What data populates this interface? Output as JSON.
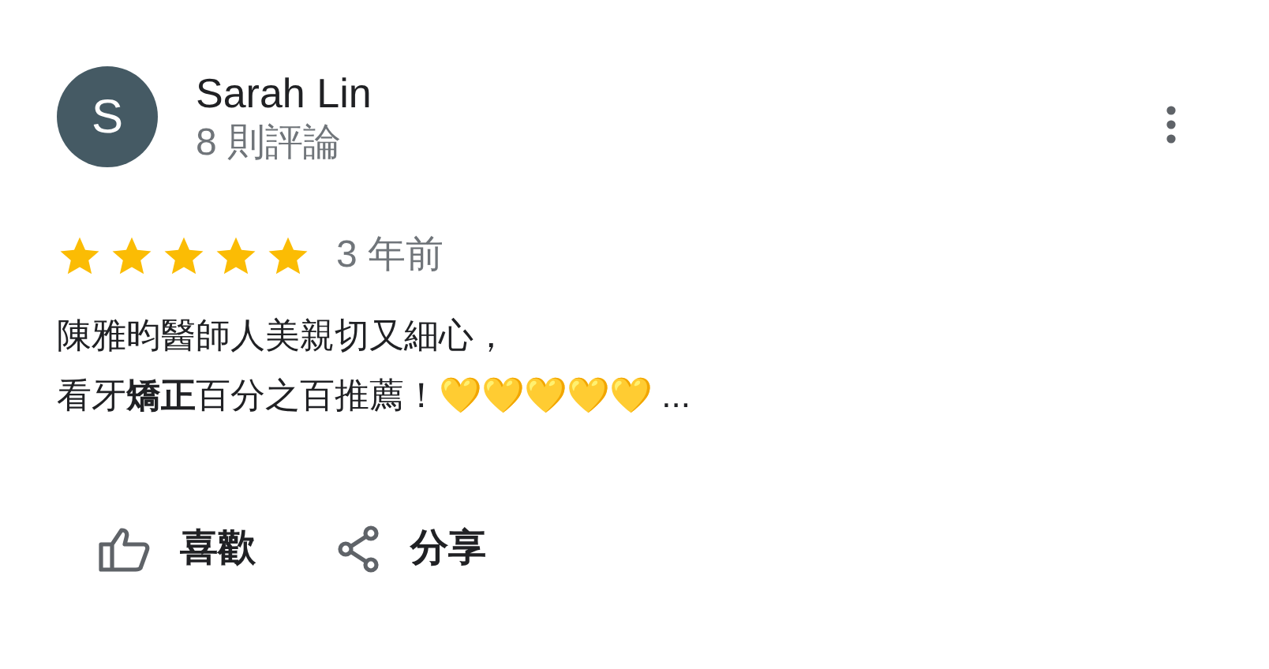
{
  "review": {
    "avatar_letter": "S",
    "author": "Sarah Lin",
    "review_count": "8 則評論",
    "stars": 5,
    "time": "3 年前",
    "text_lines": [
      "陳雅昀醫師人美親切又細心，",
      "看牙**矯正**百分之百推薦！💛💛💛💛💛 ..."
    ]
  },
  "actions": [
    {
      "kind": "like",
      "label": "喜歡"
    },
    {
      "kind": "share",
      "label": "分享"
    }
  ]
}
